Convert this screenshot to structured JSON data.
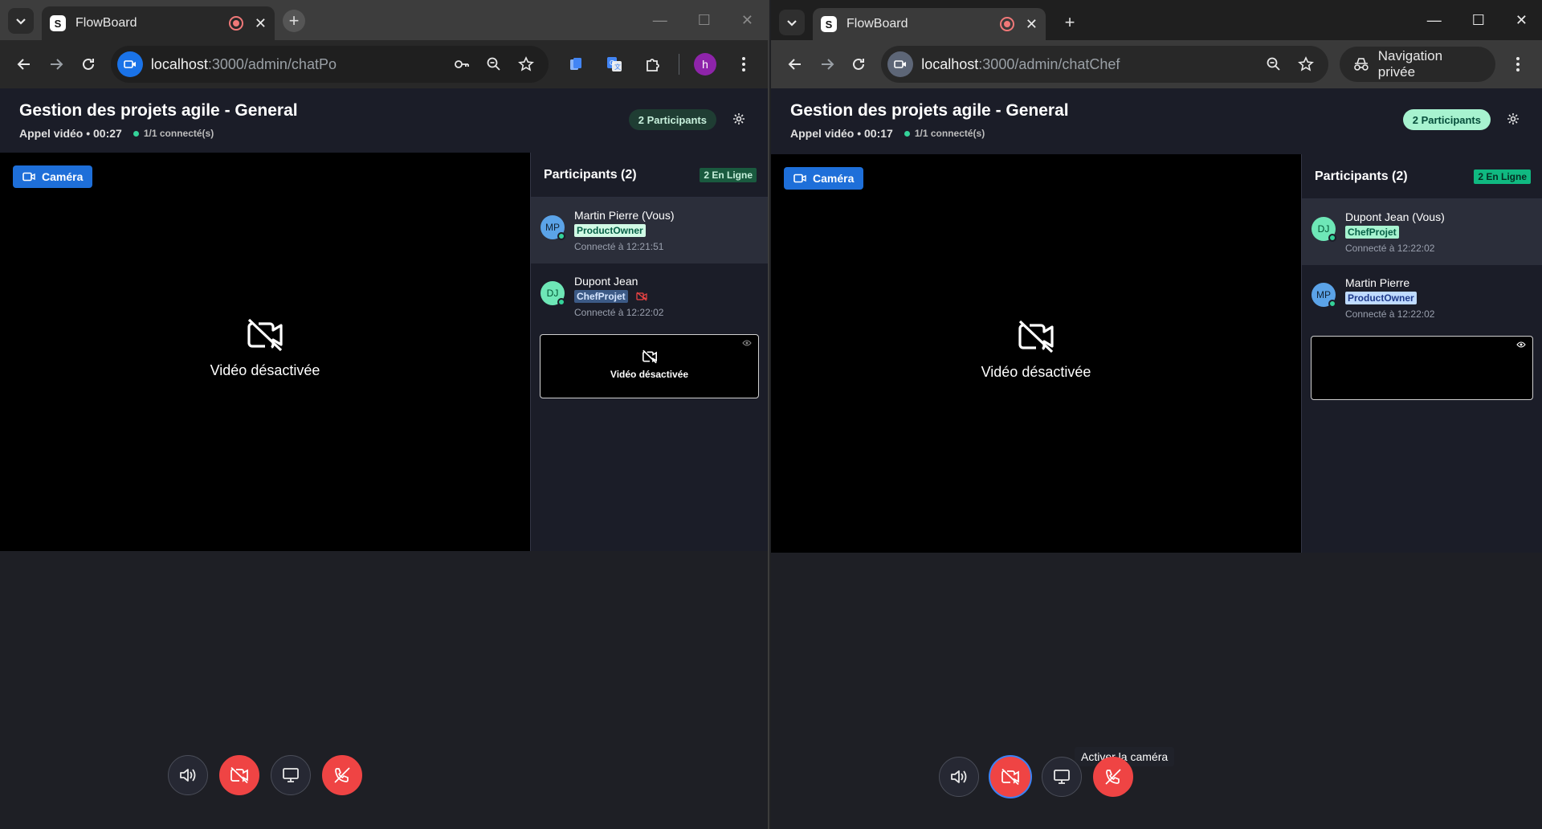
{
  "left": {
    "tab_title": "FlowBoard",
    "url_host": "localhost",
    "url_path": ":3000/admin/chatPo",
    "profile_initial": "h",
    "app_title": "Gestion des projets agile - General",
    "call_info": "Appel vidéo • 00:27",
    "connected": "1/1 connecté(s)",
    "participants_badge": "2 Participants",
    "camera_button": "Caméra",
    "video_off": "Vidéo désactivée",
    "panel_title": "Participants (2)",
    "online_badge": "2 En Ligne",
    "participants": [
      {
        "initials": "MP",
        "name": "Martin Pierre (Vous)",
        "role": "ProductOwner",
        "connected": "Connecté à 12:21:51"
      },
      {
        "initials": "DJ",
        "name": "Dupont Jean",
        "role": "ChefProjet",
        "connected": "Connecté à 12:22:02"
      }
    ],
    "thumb_label": "Vidéo désactivée"
  },
  "right": {
    "tab_title": "FlowBoard",
    "url_host": "localhost",
    "url_path": ":3000/admin/chatChef",
    "private_label": "Navigation privée",
    "app_title": "Gestion des projets agile - General",
    "call_info": "Appel vidéo • 00:17",
    "connected": "1/1 connecté(s)",
    "participants_badge": "2 Participants",
    "camera_button": "Caméra",
    "video_off": "Vidéo désactivée",
    "panel_title": "Participants (2)",
    "online_badge": "2 En Ligne",
    "participants": [
      {
        "initials": "DJ",
        "name": "Dupont Jean (Vous)",
        "role": "ChefProjet",
        "connected": "Connecté à 12:22:02"
      },
      {
        "initials": "MP",
        "name": "Martin Pierre",
        "role": "ProductOwner",
        "connected": "Connecté à 12:22:02"
      }
    ],
    "tooltip": "Activer la caméra"
  },
  "icons": {
    "back": "arrow-left-icon",
    "forward": "arrow-right-icon",
    "reload": "reload-icon",
    "key": "key-icon",
    "zoom": "zoom-out-icon",
    "star": "star-icon",
    "extensions": "puzzle-icon",
    "menu": "kebab-menu-icon",
    "volume": "volume-icon",
    "camera_off": "camera-off-icon",
    "screen_share": "monitor-icon",
    "hang_up": "phone-off-icon",
    "settings": "gear-icon"
  },
  "colors": {
    "accent_blue": "#1e6fd9",
    "danger_red": "#ef4444",
    "online_green": "#34d399",
    "video_bg": "#000000",
    "app_bg": "#1e1f25"
  }
}
